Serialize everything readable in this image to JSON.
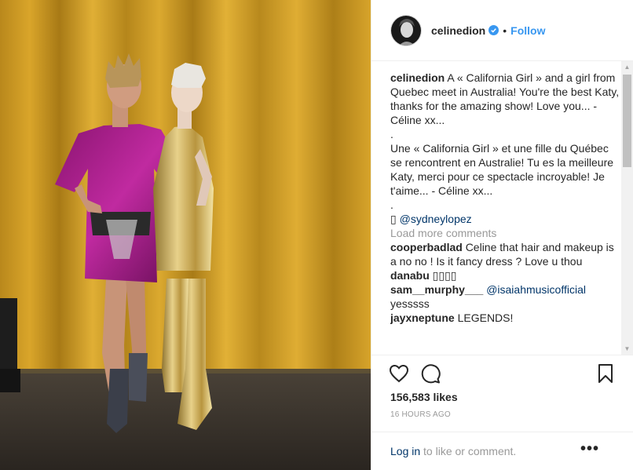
{
  "post": {
    "username": "celinedion",
    "follow_label": "Follow",
    "separator": "•"
  },
  "caption": {
    "username": "celinedion",
    "english": "A « California Girl » and a girl from Quebec meet in Australia! You're the best Katy, thanks for the amazing show! Love you... - Céline xx...",
    "dot1": ".",
    "french": "Une « California Girl » et une fille du Québec se rencontrent en Australie! Tu es la meilleure Katy, merci pour ce spectacle incroyable! Je t'aime... - Céline xx...",
    "dot2": ".",
    "credit_glyph": "▯",
    "credit_mention": "@sydneylopez"
  },
  "load_more": "Load more comments",
  "comments": [
    {
      "user": "cooperbadlad",
      "text": "Celine that hair and makeup is a no no ! Is it fancy dress ? Love u thou"
    },
    {
      "user": "danabu",
      "text": "▯▯▯▯"
    },
    {
      "user": "sam__murphy___",
      "mention": "@isaiahmusicofficial",
      "text": "yesssss"
    },
    {
      "user": "jayxneptune",
      "text": "LEGENDS!"
    }
  ],
  "likes": "156,583 likes",
  "timestamp": "16 HOURS AGO",
  "login": {
    "link": "Log in",
    "rest": " to like or comment."
  },
  "more_label": "•••",
  "icons": [
    "heart-icon",
    "comment-icon",
    "bookmark-icon",
    "verified-badge-icon",
    "more-options-icon"
  ],
  "colors": {
    "accent": "#3897f0",
    "verified": "#3897f0",
    "muted": "#999999",
    "link": "#003569"
  }
}
